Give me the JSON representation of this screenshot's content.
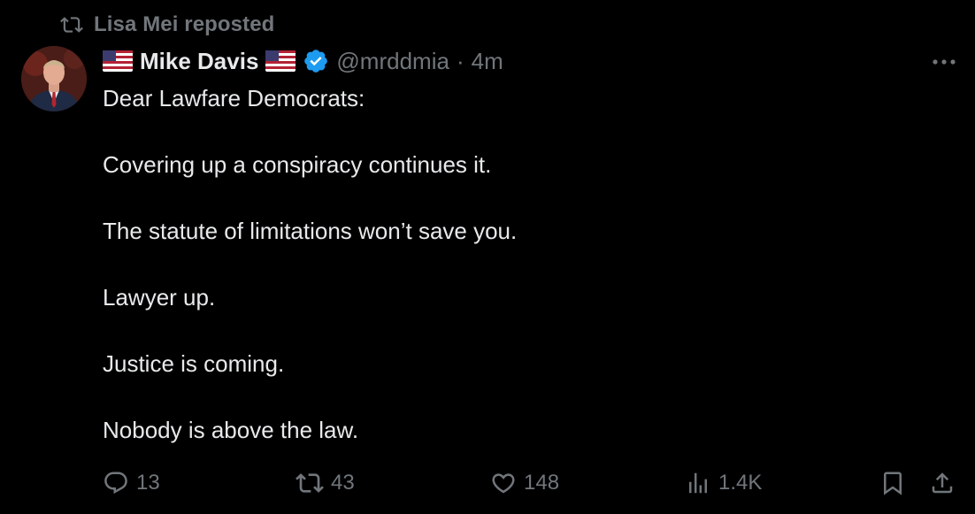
{
  "repost": {
    "label": "Lisa Mei reposted",
    "icon": "repost-icon"
  },
  "author": {
    "name": "Mike Davis",
    "handle": "@mrddmia",
    "separator": "·",
    "time": "4m",
    "flag_icon": "us-flag-icon",
    "verified_icon": "verified-badge-icon",
    "verified_color": "#1d9bf0"
  },
  "tweet": {
    "lines": [
      "Dear Lawfare Democrats:",
      "Covering up a conspiracy continues it.",
      "The statute of limitations won’t save you.",
      "Lawyer up.",
      "Justice is coming.",
      "Nobody is above the law."
    ]
  },
  "actions": {
    "replies": "13",
    "reposts": "43",
    "likes": "148",
    "views": "1.4K"
  },
  "colors": {
    "background": "#000000",
    "text": "#e7e9ea",
    "muted": "#71767b",
    "accent": "#1d9bf0"
  }
}
